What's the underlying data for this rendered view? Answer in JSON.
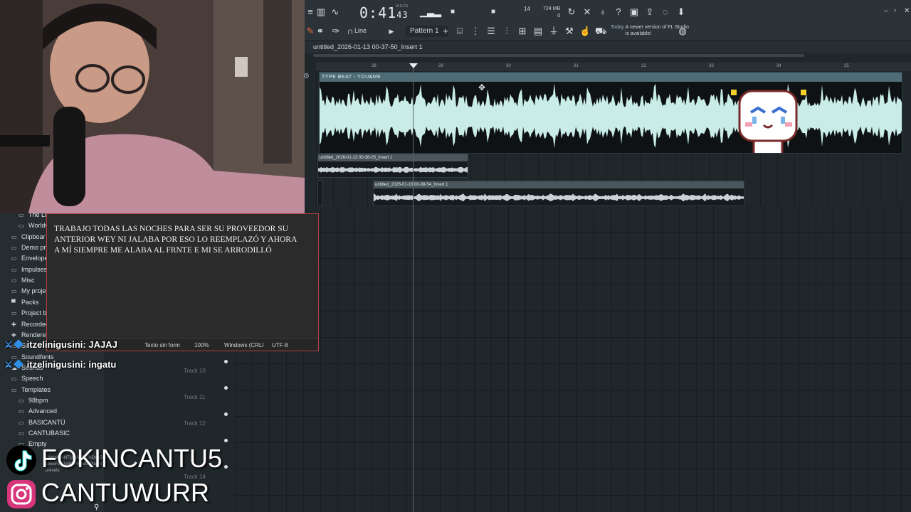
{
  "toolbar": {
    "clock": "0:41",
    "clock_sub": "43",
    "clock_unit": "M:S:CS",
    "cpu_value": "14",
    "memory": "724 MB",
    "memory_sub": "0",
    "line_mode": "Line",
    "pattern": "Pattern 1",
    "news_date": "Today",
    "news_text": "A newer version of FL Studio is available!",
    "icons": [
      "note-icon",
      "waveform-icon",
      "metronome-icon",
      "record-icon",
      "mixer-icon",
      "piano-roll-icon",
      "plugin-icon",
      "help-icon",
      "save-icon",
      "export-icon",
      "chat-icon",
      "download-icon"
    ]
  },
  "playlist": {
    "title": "untitled_2026-01-13 00-37-50_Insert 1",
    "ruler": [
      "28",
      "29",
      "30",
      "31",
      "32",
      "33",
      "34",
      "35"
    ],
    "clips": {
      "main_label": "TYPE BEAT - YOU&ME",
      "clip2_label": "untitled_2026-01-13 00-38-05_Insert 1",
      "clip3_label": "untitled_2026-01-13 00-38-54_Insert 1"
    },
    "tracks": [
      "Track 10",
      "Track 11",
      "Track 12",
      "Track 14"
    ]
  },
  "browser": {
    "items": [
      {
        "label": "The Lu",
        "icon": "folder-icon",
        "indent": 1
      },
      {
        "label": "Worldv",
        "icon": "folder-icon",
        "indent": 1
      },
      {
        "label": "Clipboar",
        "icon": "folder-icon",
        "indent": 0
      },
      {
        "label": "Demo pr",
        "icon": "folder-icon",
        "indent": 0
      },
      {
        "label": "Envelope",
        "icon": "folder-icon",
        "indent": 0
      },
      {
        "label": "Impulses",
        "icon": "folder-icon",
        "indent": 0
      },
      {
        "label": "Misc",
        "icon": "folder-icon",
        "indent": 0
      },
      {
        "label": "My proje",
        "icon": "folder-icon",
        "indent": 0
      },
      {
        "label": "Packs",
        "icon": "packs-icon",
        "indent": 0
      },
      {
        "label": "Project b",
        "icon": "folder-icon",
        "indent": 0
      },
      {
        "label": "Recorded",
        "icon": "record-icon",
        "indent": 0
      },
      {
        "label": "Rendere",
        "icon": "render-icon",
        "indent": 0
      },
      {
        "label": "Sli",
        "icon": "folder-icon",
        "indent": 0
      },
      {
        "label": "Soundfonts",
        "icon": "folder-icon",
        "indent": 0
      },
      {
        "label": "Sounds",
        "icon": "cloud-icon",
        "indent": 0
      },
      {
        "label": "Speech",
        "icon": "speech-icon",
        "indent": 0
      },
      {
        "label": "Templates",
        "icon": "folder-icon",
        "indent": 0
      },
      {
        "label": "98bpm",
        "icon": "folder-icon",
        "indent": 1
      },
      {
        "label": "Advanced",
        "icon": "folder-icon",
        "indent": 1
      },
      {
        "label": "BASICANTÚ",
        "icon": "folder-icon",
        "indent": 1
      },
      {
        "label": "CANTUBASIC",
        "icon": "folder-icon",
        "indent": 1
      },
      {
        "label": "Empty",
        "icon": "folder-icon",
        "indent": 1
      }
    ],
    "path_text": "Users\\CANTUMASTER\\OneDrive\\Documents\\Image-Line\\FL Studio\\Presets\\Plugin presets"
  },
  "notepad": {
    "text": "TRABAJO TODAS LAS NOCHES PARA SER SU PROVEEDOR SU ANTERIOR WEY NI JALABA POR ESO LO REEMPLAZÓ Y AHORA A MÍ SIEMPRE ME ALABA AL FRNTE E MI SE ARRODILLÓ",
    "status_format": "Texto sin form",
    "status_zoom": "100%",
    "status_eol": "Windows (CRLI",
    "status_encoding": "UTF-8"
  },
  "chat": [
    {
      "user": "itzelinigusini",
      "message": "JAJAJ"
    },
    {
      "user": "itzelinigusini",
      "message": "ingatu"
    }
  ],
  "socials": {
    "tiktok": "FOKINCANTU5",
    "instagram": "CANTUWURR"
  },
  "colors": {
    "waveform": "#c9ece6",
    "clip_header": "#4d6c75",
    "accent_red": "#b04040"
  }
}
